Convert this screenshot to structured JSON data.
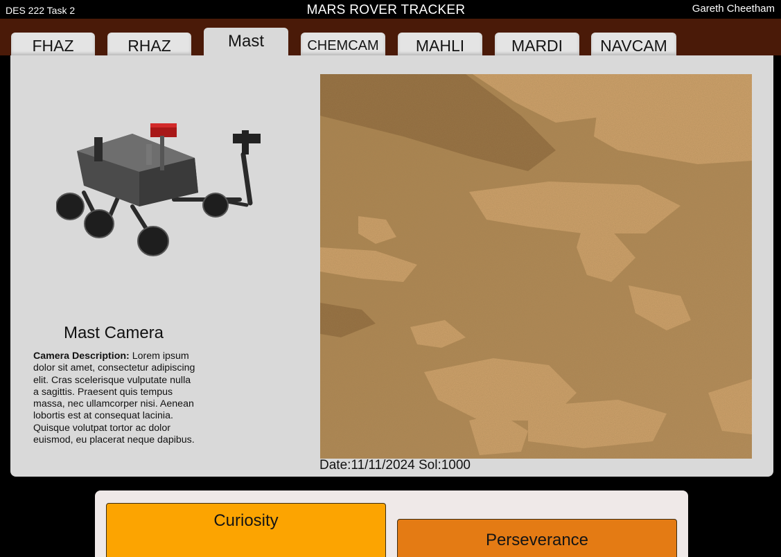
{
  "header": {
    "course": "DES 222 Task 2",
    "title": "MARS ROVER TRACKER",
    "user": "Gareth Cheetham"
  },
  "tabs": [
    {
      "label": "FHAZ",
      "active": false
    },
    {
      "label": "RHAZ",
      "active": false
    },
    {
      "label": "Mast",
      "active": true
    },
    {
      "label": "CHEMCAM",
      "active": false
    },
    {
      "label": "MAHLI",
      "active": false
    },
    {
      "label": "MARDI",
      "active": false
    },
    {
      "label": "NAVCAM",
      "active": false
    }
  ],
  "camera": {
    "title": "Mast Camera",
    "desc_label": "Camera Description:",
    "desc_text": "Lorem ipsum dolor sit amet, consectetur adipiscing elit. Cras scelerisque vulputate nulla a sagittis. Praesent quis tempus massa, nec ullamcorper nisi. Aenean lobortis est at consequat lacinia. Quisque volutpat tortor ac dolor euismod, eu placerat neque dapibus."
  },
  "photo": {
    "date_label": "Date:",
    "date": "11/11/2024",
    "sol_label": "Sol:",
    "sol": "1000"
  },
  "rovers": [
    {
      "label": "Curiosity",
      "color": "#fca401"
    },
    {
      "label": "Perseverance",
      "color": "#e47b14"
    }
  ],
  "colors": {
    "tab_strip": "#4a1a08",
    "panel": "#d9d9d9",
    "selector": "#efe9e8"
  }
}
